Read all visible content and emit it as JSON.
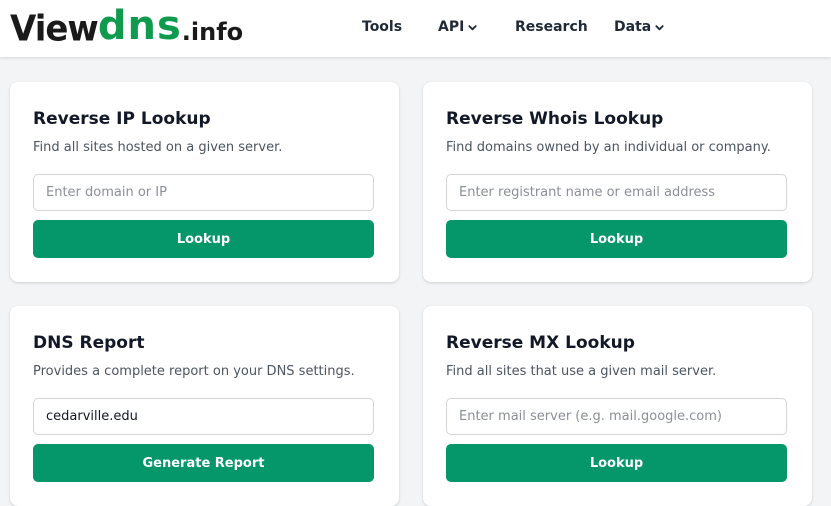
{
  "brand": {
    "view": "View",
    "dns": "dns",
    "info": ".info"
  },
  "nav": {
    "tools": "Tools",
    "api": "API",
    "research": "Research",
    "data": "Data"
  },
  "cards": [
    {
      "title": "Reverse IP Lookup",
      "description": "Find all sites hosted on a given server.",
      "input_value": "",
      "placeholder": "Enter domain or IP",
      "button": "Lookup"
    },
    {
      "title": "Reverse Whois Lookup",
      "description": "Find domains owned by an individual or company.",
      "input_value": "",
      "placeholder": "Enter registrant name or email address",
      "button": "Lookup"
    },
    {
      "title": "DNS Report",
      "description": "Provides a complete report on your DNS settings.",
      "input_value": "cedarville.edu",
      "placeholder": "",
      "button": "Generate Report"
    },
    {
      "title": "Reverse MX Lookup",
      "description": "Find all sites that use a given mail server.",
      "input_value": "",
      "placeholder": "Enter mail server (e.g. mail.google.com)",
      "button": "Lookup"
    }
  ],
  "colors": {
    "accent": "#059669",
    "brand_green": "#0f9a4d",
    "background": "#f3f4f6"
  },
  "icons": {
    "dropdown": "chevron-down-icon"
  }
}
